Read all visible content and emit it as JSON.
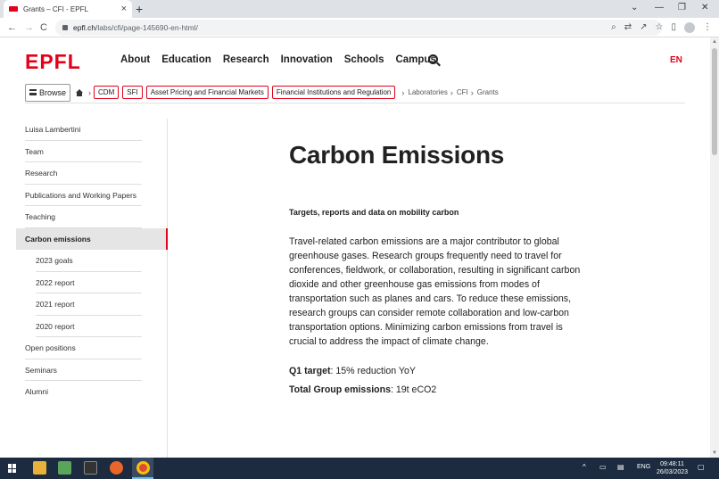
{
  "browser": {
    "tab_title": "Grants – CFI - EPFL",
    "tab_close": "×",
    "new_tab": "+",
    "url_host": "epfl.ch",
    "url_path": "/labs/cfi/page-145690-en-html/",
    "nav_back": "←",
    "nav_forward": "→",
    "nav_reload": "C",
    "win_minimize": "⌄",
    "win_min": "—",
    "win_max": "❐",
    "win_close": "✕",
    "icons": [
      "search-icon",
      "translate-icon",
      "share-icon",
      "star-icon",
      "side-panel-icon",
      "profile-icon",
      "menu-icon"
    ]
  },
  "site": {
    "logo": "EPFL",
    "nav": [
      "About",
      "Education",
      "Research",
      "Innovation",
      "Schools",
      "Campus"
    ],
    "lang": "EN"
  },
  "breadcrumb": {
    "browse_label": "Browse",
    "tags": [
      "CDM",
      "SFI",
      "Asset Pricing and Financial Markets",
      "Financial Institutions and Regulation"
    ],
    "trail": [
      "Laboratories",
      "CFI",
      "Grants"
    ]
  },
  "sidebar": {
    "items": [
      {
        "label": "Luisa Lambertini"
      },
      {
        "label": "Team"
      },
      {
        "label": "Research"
      },
      {
        "label": "Publications and Working Papers"
      },
      {
        "label": "Teaching"
      },
      {
        "label": "Carbon emissions"
      },
      {
        "label": "2023 goals"
      },
      {
        "label": "2022 report"
      },
      {
        "label": "2021 report"
      },
      {
        "label": "2020 report"
      },
      {
        "label": "Open positions"
      },
      {
        "label": "Seminars"
      },
      {
        "label": "Alumni"
      }
    ]
  },
  "content": {
    "title": "Carbon Emissions",
    "lead": "Targets, reports and data on mobility carbon",
    "body": "Travel-related carbon emissions are a major contributor to global greenhouse gases. Research groups frequently need to travel for conferences, fieldwork, or collaboration, resulting in significant carbon dioxide and other greenhouse gas emissions from modes of transportation such as planes and cars. To reduce these emissions, research groups can consider remote collaboration and low-carbon transportation options. Minimizing carbon emissions from travel is crucial to address the impact of climate change.",
    "q1_label": "Q1 target",
    "q1_value": ": 15% reduction YoY",
    "total_label": "Total Group emissions",
    "total_value": ": 19t eCO2"
  },
  "taskbar": {
    "tray_lang": "ENG",
    "tray_up": "^",
    "time": "09:48:11",
    "date": "26/03/2023"
  },
  "colors": {
    "brand_red": "#e2001a",
    "taskbar": "#1c2b3f"
  }
}
